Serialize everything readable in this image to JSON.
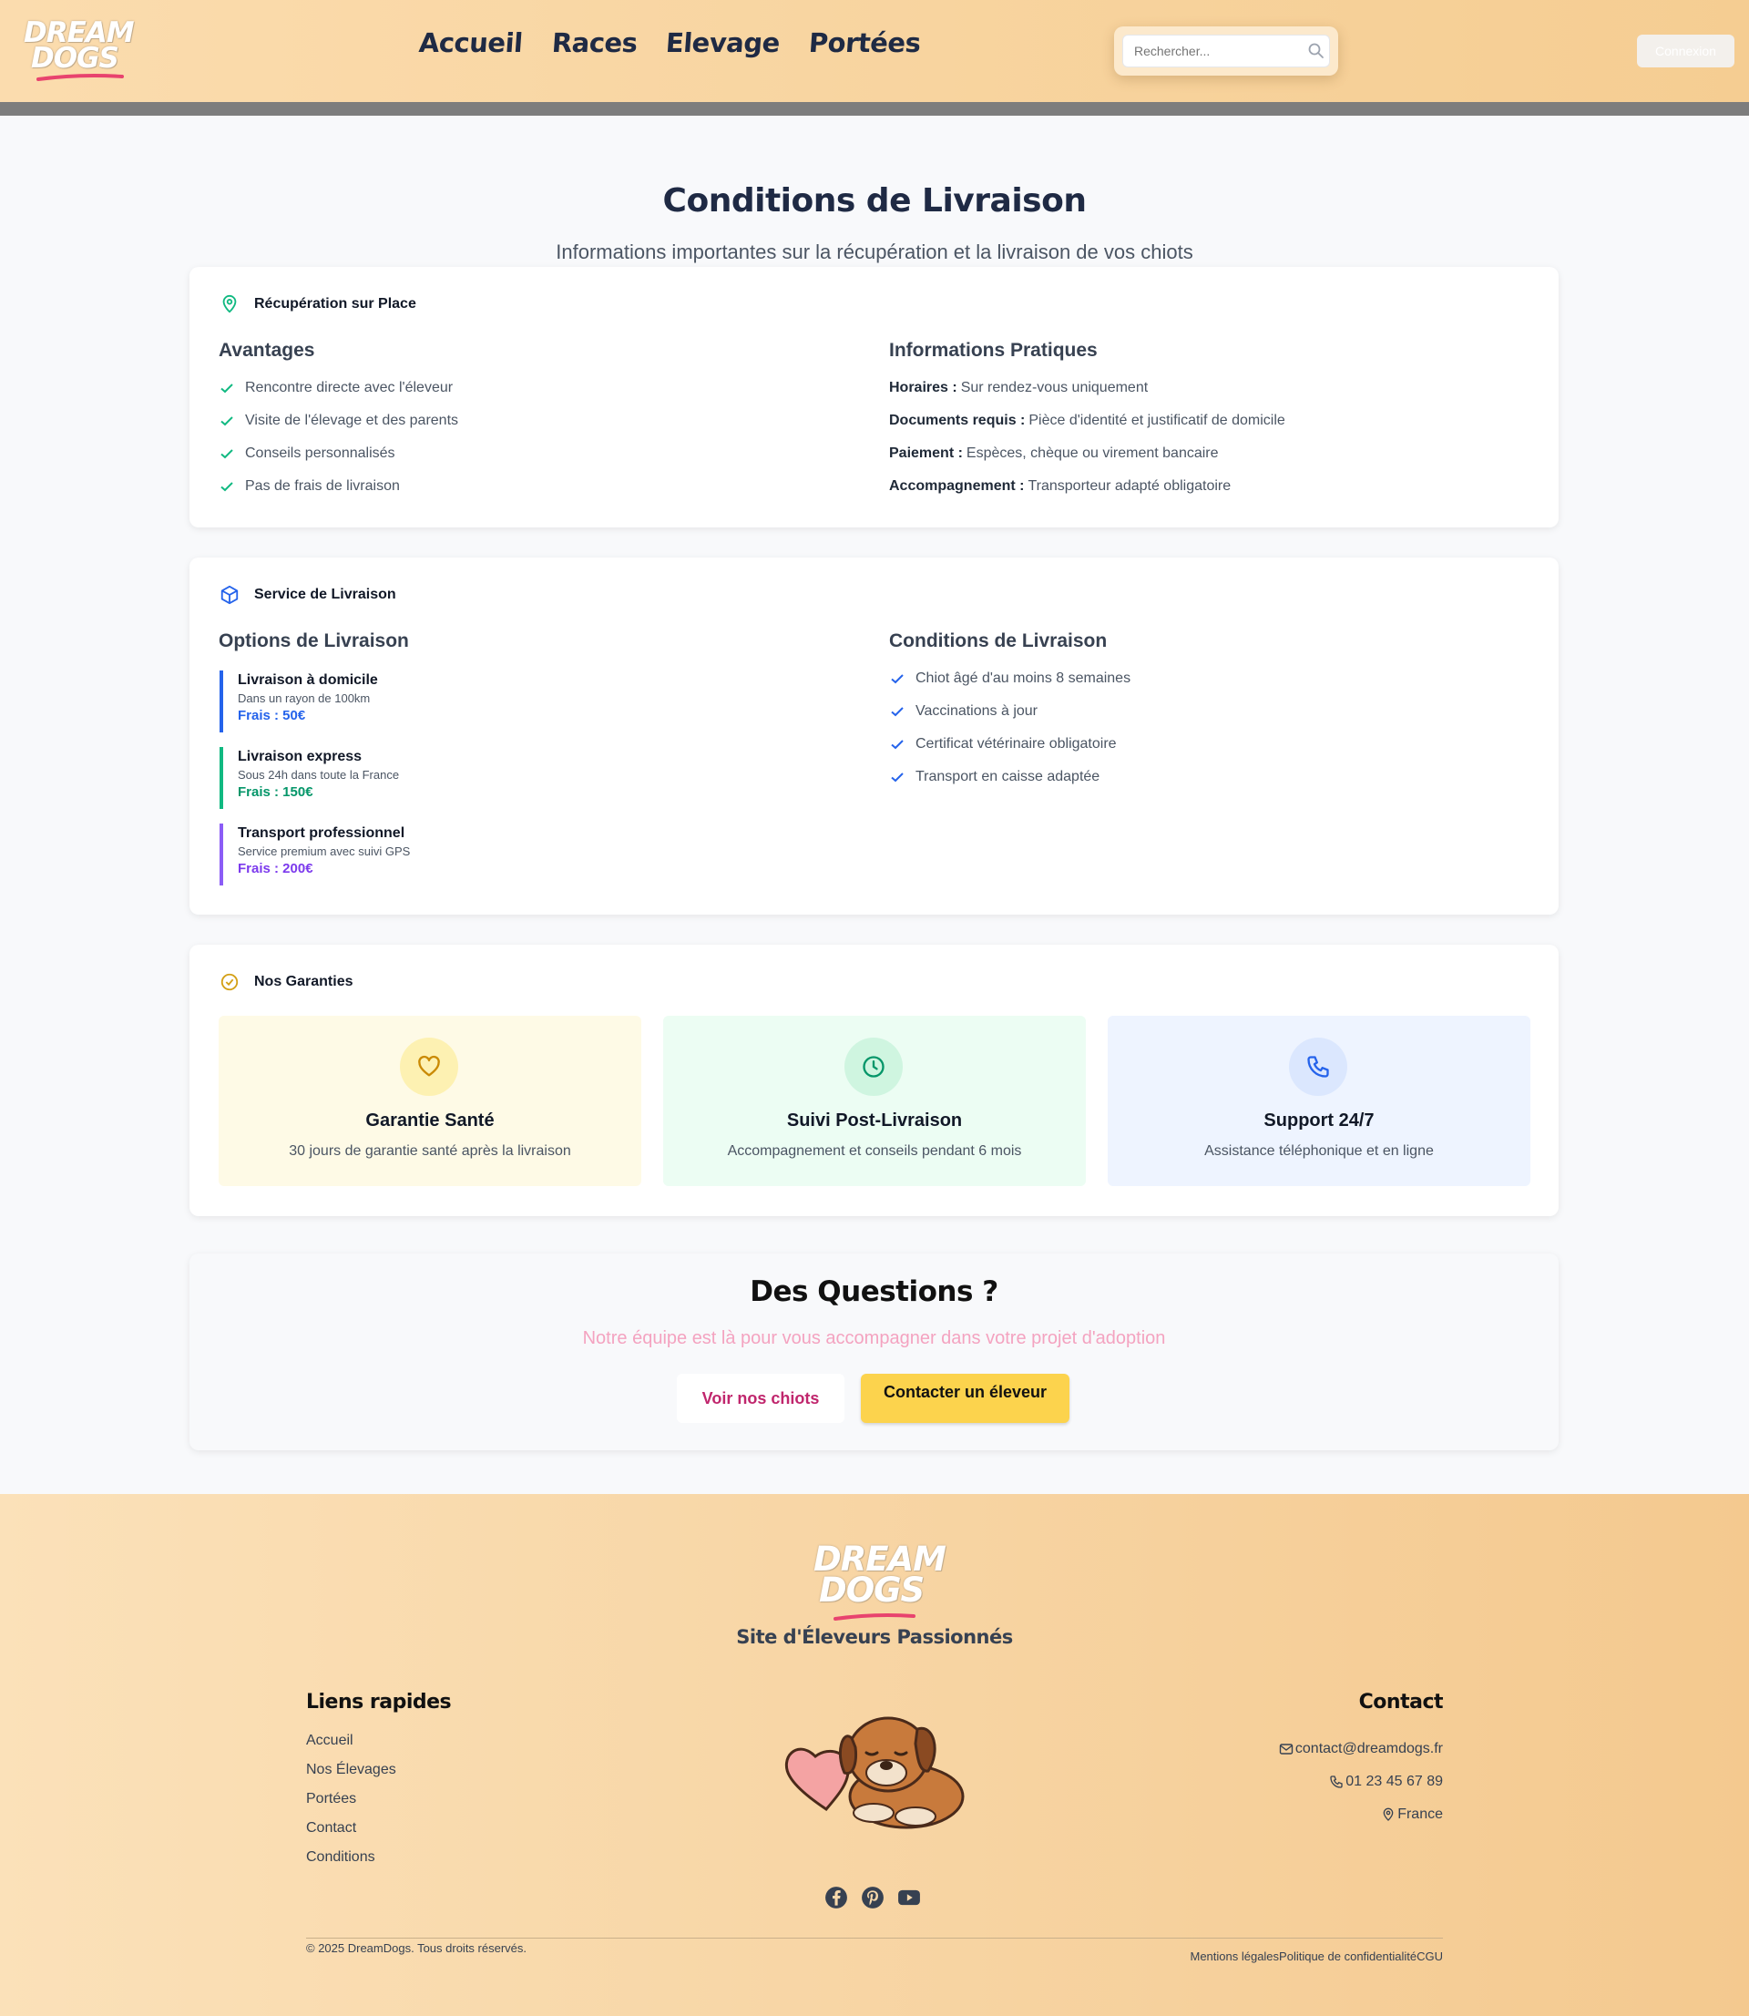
{
  "header": {
    "logo_line1": "DREAM",
    "logo_line2": "DOGS",
    "nav": [
      "Accueil",
      "Races",
      "Elevage",
      "Portées"
    ],
    "search_placeholder": "Rechercher...",
    "login_label": "Connexion"
  },
  "page": {
    "title": "Conditions de Livraison",
    "subtitle": "Informations importantes sur la récupération et la livraison de vos chiots"
  },
  "pickup": {
    "title": "Récupération sur Place",
    "advantages_title": "Avantages",
    "advantages": [
      "Rencontre directe avec l'éleveur",
      "Visite de l'élevage et des parents",
      "Conseils personnalisés",
      "Pas de frais de livraison"
    ],
    "info_title": "Informations Pratiques",
    "info": [
      {
        "label": "Horaires :",
        "value": "Sur rendez-vous uniquement"
      },
      {
        "label": "Documents requis :",
        "value": "Pièce d'identité et justificatif de domicile"
      },
      {
        "label": "Paiement :",
        "value": "Espèces, chèque ou virement bancaire"
      },
      {
        "label": "Accompagnement :",
        "value": "Transporteur adapté obligatoire"
      }
    ]
  },
  "delivery": {
    "title": "Service de Livraison",
    "options_title": "Options de Livraison",
    "options": [
      {
        "name": "Livraison à domicile",
        "desc": "Dans un rayon de 100km",
        "price": "Frais : 50€",
        "color": "#2563eb"
      },
      {
        "name": "Livraison express",
        "desc": "Sous 24h dans toute la France",
        "price": "Frais : 150€",
        "color": "#059669"
      },
      {
        "name": "Transport professionnel",
        "desc": "Service premium avec suivi GPS",
        "price": "Frais : 200€",
        "color": "#7c3aed"
      }
    ],
    "conditions_title": "Conditions de Livraison",
    "conditions": [
      "Chiot âgé d'au moins 8 semaines",
      "Vaccinations à jour",
      "Certificat vétérinaire obligatoire",
      "Transport en caisse adaptée"
    ]
  },
  "guarantees": {
    "title": "Nos Garanties",
    "items": [
      {
        "title": "Garantie Santé",
        "desc": "30 jours de garantie santé après la livraison",
        "icon": "heart-icon"
      },
      {
        "title": "Suivi Post-Livraison",
        "desc": "Accompagnement et conseils pendant 6 mois",
        "icon": "clock-icon"
      },
      {
        "title": "Support 24/7",
        "desc": "Assistance téléphonique et en ligne",
        "icon": "phone-icon"
      }
    ]
  },
  "questions": {
    "title": "Des Questions ?",
    "subtitle": "Notre équipe est là pour vous accompagner dans votre projet d'adoption",
    "btn_puppies": "Voir nos chiots",
    "btn_contact": "Contacter un éleveur"
  },
  "footer": {
    "logo_line1": "DREAM",
    "logo_line2": "DOGS",
    "tagline": "Site d'Éleveurs Passionnés",
    "links_title": "Liens rapides",
    "links": [
      "Accueil",
      "Nos Élevages",
      "Portées",
      "Contact",
      "Conditions"
    ],
    "contact_title": "Contact",
    "email": "contact@dreamdogs.fr",
    "phone": "01 23 45 67 89",
    "location": "France",
    "copyright": "© 2025 DreamDogs. Tous droits réservés.",
    "legal": [
      "Mentions légales",
      "Politique de confidentialité",
      "CGU"
    ]
  },
  "colors": {
    "accent_pink": "#c0266d",
    "accent_yellow": "#fcd34d",
    "check_green": "#10b981",
    "check_blue": "#2563eb"
  }
}
